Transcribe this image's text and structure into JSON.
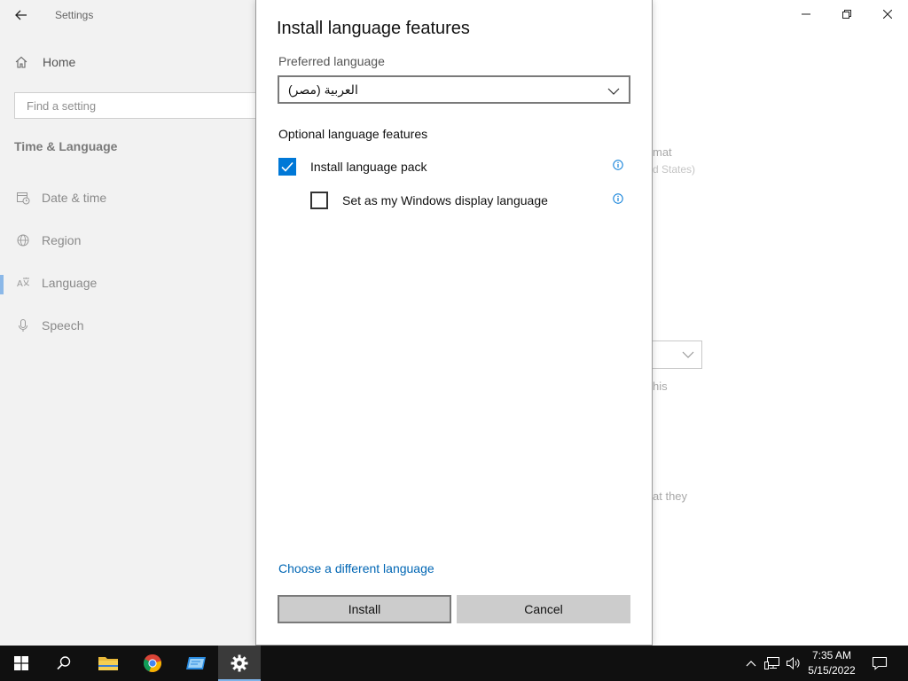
{
  "settings": {
    "title": "Settings",
    "home_label": "Home",
    "search_placeholder": "Find a setting",
    "section_title": "Time & Language",
    "nav_items": [
      {
        "label": "Date & time",
        "icon": "calendar-clock-icon"
      },
      {
        "label": "Region",
        "icon": "globe-icon"
      },
      {
        "label": "Language",
        "icon": "language-icon"
      },
      {
        "label": "Speech",
        "icon": "microphone-icon"
      }
    ],
    "active_nav": "Language",
    "right_fragments": {
      "format_partial": "mat",
      "region_partial": "d States)",
      "this_partial": "his",
      "they_partial": "at they"
    }
  },
  "dialog": {
    "title": "Install language features",
    "preferred_language_label": "Preferred language",
    "selected_language": "العربية (مصر)",
    "optional_heading": "Optional language features",
    "options": [
      {
        "label": "Install language pack",
        "checked": true
      },
      {
        "label": "Set as my Windows display language",
        "checked": false
      }
    ],
    "link_text": "Choose a different language",
    "install_label": "Install",
    "cancel_label": "Cancel",
    "accent_color": "#0078d7"
  },
  "taskbar": {
    "time": "7:35 AM",
    "date": "5/15/2022",
    "apps": [
      "start",
      "search",
      "file-explorer",
      "chrome",
      "app-window",
      "settings"
    ],
    "active_app": "settings"
  }
}
